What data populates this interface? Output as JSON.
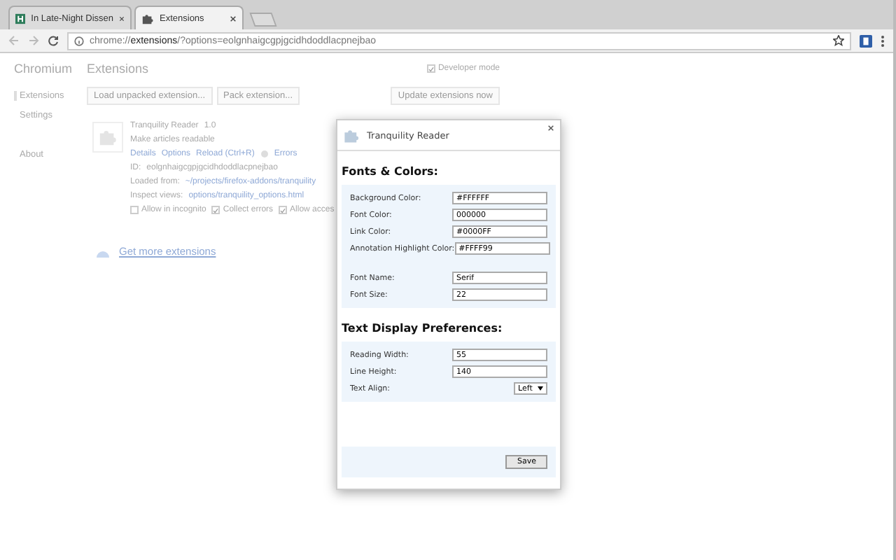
{
  "tabs": [
    {
      "title": "In Late-Night Dissen",
      "selected": false
    },
    {
      "title": "Extensions",
      "selected": true
    }
  ],
  "address_bar": {
    "scheme": "chrome://",
    "host": "extensions",
    "path": "/?options=eolgnhaigcgpjgcidhdoddlacpnejbao"
  },
  "sidebar": {
    "title": "Chromium",
    "items": [
      {
        "label": "Extensions",
        "selected": true
      },
      {
        "label": "Settings",
        "selected": false
      },
      {
        "label": "About",
        "selected": false
      }
    ]
  },
  "page": {
    "title": "Extensions",
    "developer_mode": {
      "label": "Developer mode",
      "checked": true
    },
    "buttons": [
      "Load unpacked extension...",
      "Pack extension...",
      "Update extensions now"
    ],
    "extension": {
      "name": "Tranquility Reader",
      "version": "1.0",
      "description": "Make articles readable",
      "links": [
        "Details",
        "Options",
        "Reload (Ctrl+R)"
      ],
      "errors": "Errors",
      "id_label": "ID:",
      "id": "eolgnhaigcgpjgcidhdoddlacpnejbao",
      "loaded_label": "Loaded from:",
      "loaded_path": "~/projects/firefox-addons/tranquility",
      "inspect_label": "Inspect views:",
      "views": [
        "options/tranquility_options.html"
      ],
      "options": [
        {
          "label": "Allow in incognito",
          "checked": false
        },
        {
          "label": "Collect errors",
          "checked": true
        },
        {
          "label": "Allow acces",
          "checked": true
        }
      ]
    },
    "more_link": "Get more extensions"
  },
  "dialog": {
    "title": "Tranquility Reader",
    "sections": [
      {
        "heading": "Fonts & Colors:",
        "groups": [
          [
            {
              "label": "Background Color:",
              "value": "#FFFFFF",
              "kind": "text"
            },
            {
              "label": "Font Color:",
              "value": "000000",
              "kind": "text"
            },
            {
              "label": "Link Color:",
              "value": "#0000FF",
              "kind": "text"
            },
            {
              "label": "Annotation Highlight Color:",
              "value": "#FFFF99",
              "kind": "text"
            }
          ],
          [
            {
              "label": "Font Name:",
              "value": "Serif",
              "kind": "text"
            },
            {
              "label": "Font Size:",
              "value": "22",
              "kind": "text"
            }
          ]
        ]
      },
      {
        "heading": "Text Display Preferences:",
        "groups": [
          [
            {
              "label": "Reading Width:",
              "value": "55",
              "kind": "text"
            },
            {
              "label": "Line Height:",
              "value": "140",
              "kind": "text"
            },
            {
              "label": "Text Align:",
              "value": "Left",
              "kind": "select"
            }
          ]
        ]
      }
    ],
    "save": "Save"
  }
}
